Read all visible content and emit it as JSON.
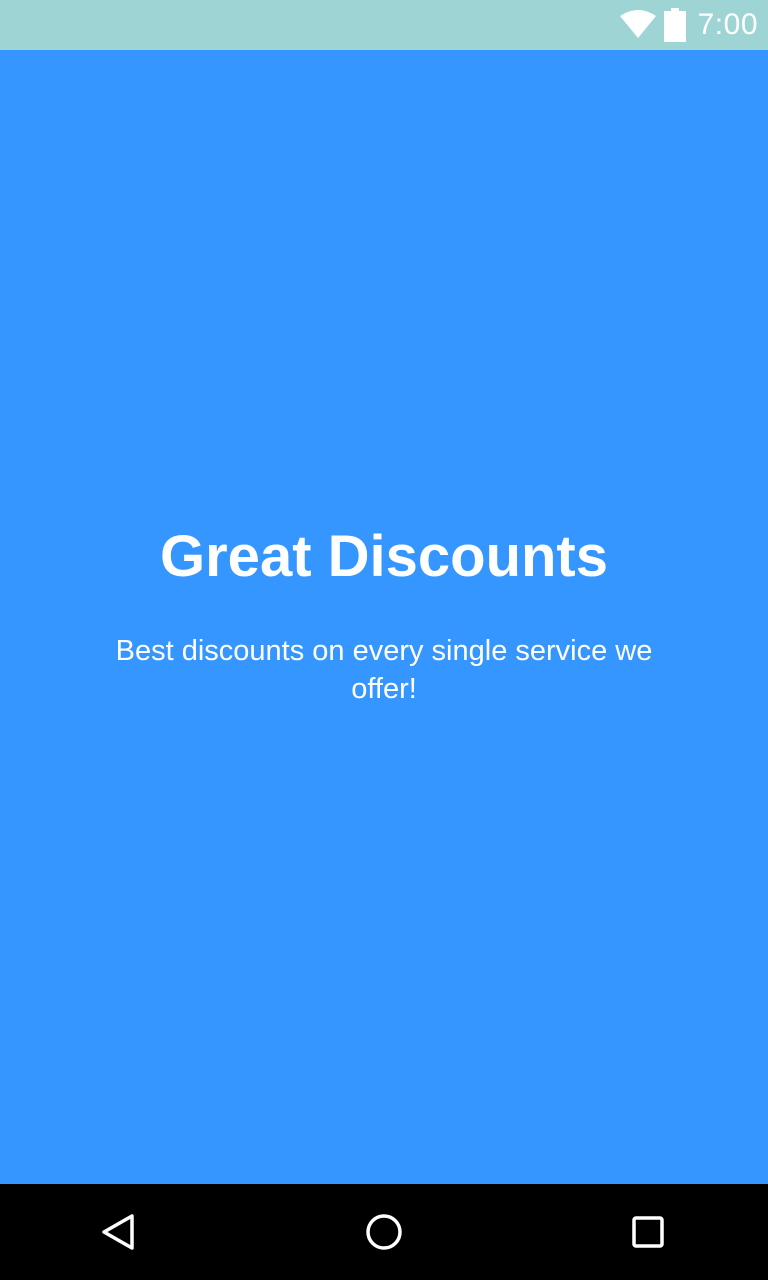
{
  "status_bar": {
    "time": "7:00",
    "background": "#9fd4d4",
    "icons": [
      "wifi-icon",
      "battery-icon"
    ]
  },
  "main": {
    "background": "#3596ff",
    "title": "Great Discounts",
    "subtitle": "Best discounts on every single service we offer!"
  },
  "nav_bar": {
    "background": "#000000",
    "buttons": [
      "back-icon",
      "home-icon",
      "recents-icon"
    ]
  }
}
